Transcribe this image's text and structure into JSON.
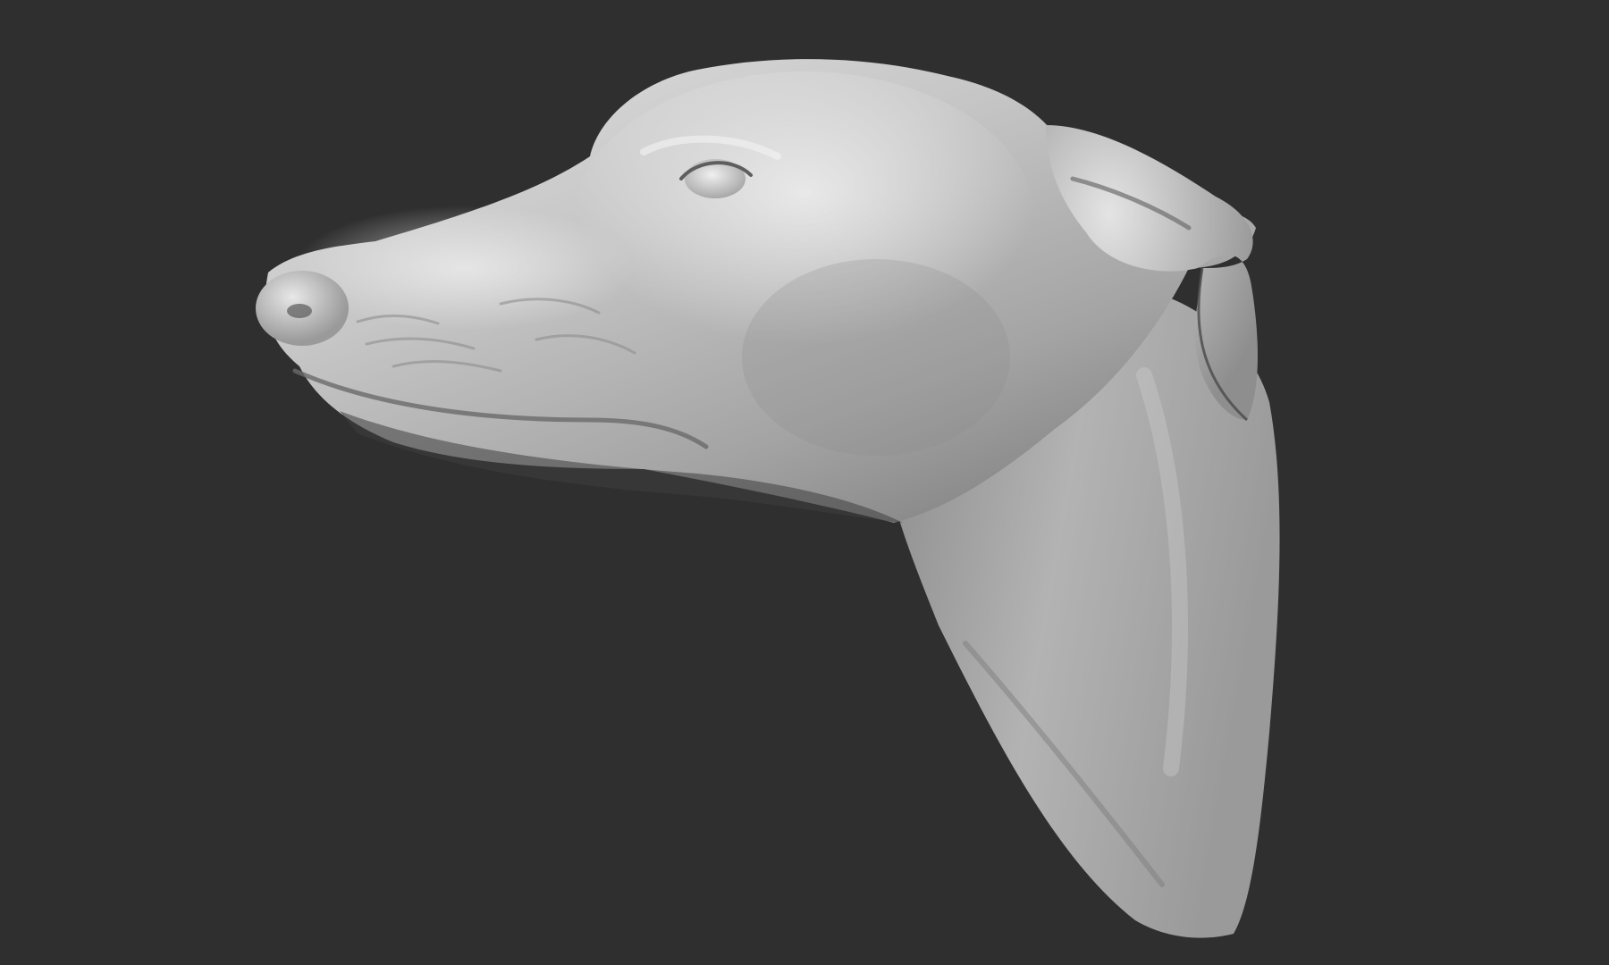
{
  "scene": {
    "subject": "sculpted-dog-head-bust",
    "material": "clay-matcap",
    "colors": {
      "background": "#2f2f2f",
      "clay_highlight": "#e6e6e6",
      "clay_mid": "#b4b4b4",
      "clay_shadow": "#5a5a5a"
    }
  }
}
